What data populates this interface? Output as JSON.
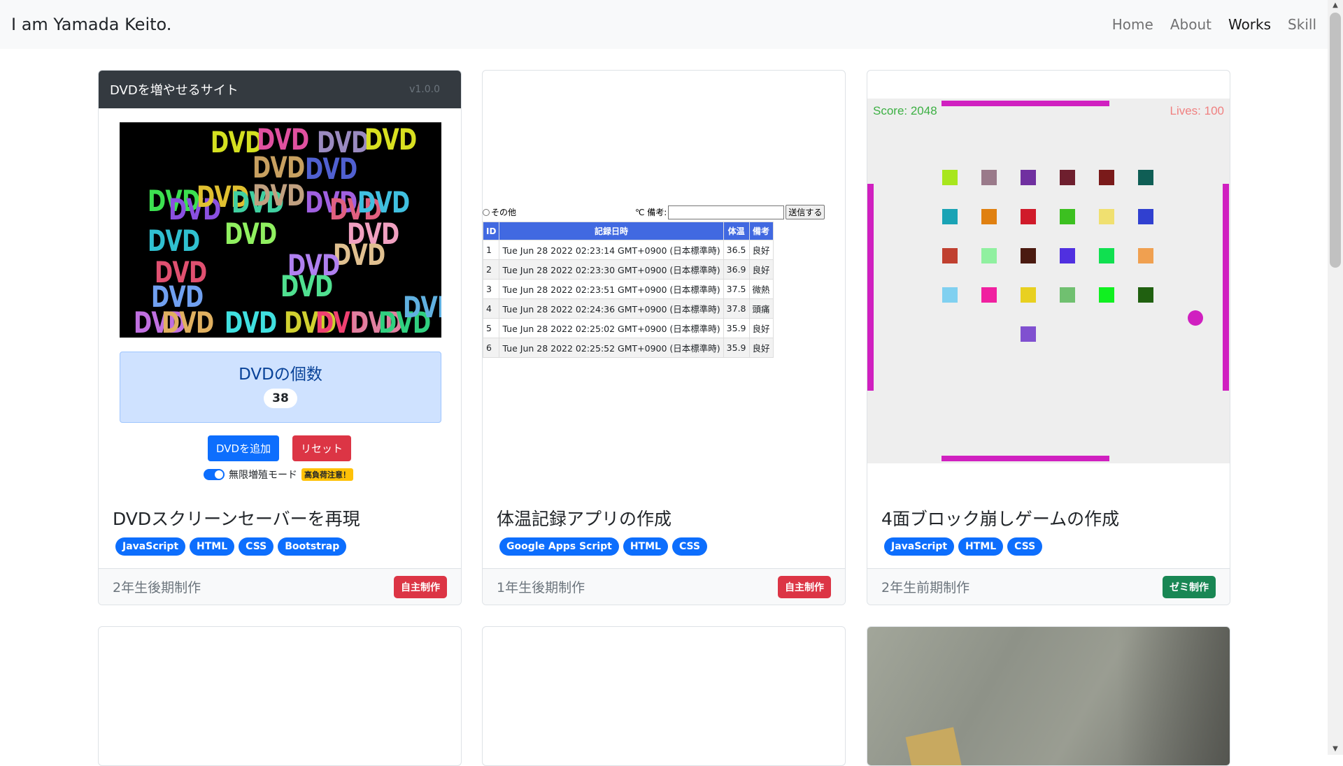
{
  "nav": {
    "brand": "I am Yamada Keito.",
    "links": [
      {
        "label": "Home",
        "active": false
      },
      {
        "label": "About",
        "active": false
      },
      {
        "label": "Works",
        "active": true
      },
      {
        "label": "Skill",
        "active": false
      }
    ]
  },
  "cards": [
    {
      "title": "DVDスクリーンセーバーを再現",
      "tags": [
        "JavaScript",
        "HTML",
        "CSS",
        "Bootstrap"
      ],
      "footer": "2年生後期制作",
      "badge": "自主制作",
      "preview": {
        "header_title": "DVDを増やせるサイト",
        "version": "v1.0.0",
        "logo_text": "DVD",
        "count_label": "DVDの個数",
        "count_value": "38",
        "add_button": "DVDを追加",
        "reset_button": "リセット",
        "toggle_label": "無限増殖モード",
        "warning": "高負荷注意！"
      }
    },
    {
      "title": "体温記録アプリの作成",
      "tags": [
        "Google Apps Script",
        "HTML",
        "CSS"
      ],
      "footer": "1年生後期制作",
      "badge": "自主制作",
      "preview": {
        "radio_label": "その他",
        "unit_remark_label": "℃ 備考:",
        "send_button": "送信する",
        "columns": [
          "ID",
          "記録日時",
          "体温",
          "備考"
        ],
        "rows": [
          [
            "1",
            "Tue Jun 28 2022 02:23:14 GMT+0900 (日本標準時)",
            "36.5",
            "良好"
          ],
          [
            "2",
            "Tue Jun 28 2022 02:23:30 GMT+0900 (日本標準時)",
            "36.9",
            "良好"
          ],
          [
            "3",
            "Tue Jun 28 2022 02:23:51 GMT+0900 (日本標準時)",
            "37.5",
            "微熱"
          ],
          [
            "4",
            "Tue Jun 28 2022 02:24:36 GMT+0900 (日本標準時)",
            "37.8",
            "頭痛"
          ],
          [
            "5",
            "Tue Jun 28 2022 02:25:02 GMT+0900 (日本標準時)",
            "35.9",
            "良好"
          ],
          [
            "6",
            "Tue Jun 28 2022 02:25:52 GMT+0900 (日本標準時)",
            "35.9",
            "良好"
          ]
        ]
      }
    },
    {
      "title": "4面ブロック崩しゲームの作成",
      "tags": [
        "JavaScript",
        "HTML",
        "CSS"
      ],
      "footer": "2年生前期制作",
      "badge": "ゼミ制作",
      "preview": {
        "score": "Score: 2048",
        "lives": "Lives: 100",
        "block_colors": [
          [
            "#a8e61d",
            "#9a7a8a",
            "#7030a0",
            "#6e1f2e",
            "#7a1a1a",
            "#0f5e55"
          ],
          [
            "#1aa3b5",
            "#e08010",
            "#d01a2a",
            "#3cc020",
            "#f0e070",
            "#3040d0"
          ],
          [
            "#c04030",
            "#90f0a0",
            "#4a1a10",
            "#5030e0",
            "#10e050",
            "#f0a050"
          ],
          [
            "#80d0f0",
            "#f020a0",
            "#e8d020",
            "#70c070",
            "#10f020",
            "#206010"
          ],
          [
            null,
            null,
            "#8050d0",
            null,
            null,
            null
          ]
        ]
      }
    }
  ]
}
